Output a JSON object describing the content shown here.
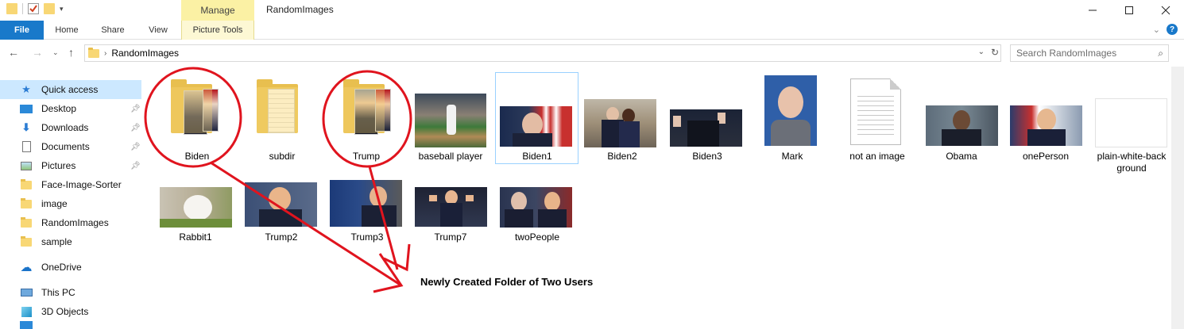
{
  "window": {
    "title": "RandomImages",
    "manage_tab": "Manage"
  },
  "ribbon": {
    "tabs": [
      {
        "label": "File"
      },
      {
        "label": "Home"
      },
      {
        "label": "Share"
      },
      {
        "label": "View"
      },
      {
        "label": "Picture Tools"
      }
    ]
  },
  "address": {
    "path": "RandomImages",
    "search_placeholder": "Search RandomImages"
  },
  "sidebar": {
    "items": [
      {
        "label": "Quick access",
        "icon": "star-icon",
        "selected": true
      },
      {
        "label": "Desktop",
        "icon": "desktop-icon",
        "pinned": true
      },
      {
        "label": "Downloads",
        "icon": "download-arrow-icon",
        "pinned": true
      },
      {
        "label": "Documents",
        "icon": "document-icon",
        "pinned": true
      },
      {
        "label": "Pictures",
        "icon": "pictures-icon",
        "pinned": true
      },
      {
        "label": "Face-Image-Sorter",
        "icon": "folder-icon"
      },
      {
        "label": "image",
        "icon": "folder-icon"
      },
      {
        "label": "RandomImages",
        "icon": "folder-icon"
      },
      {
        "label": "sample",
        "icon": "folder-icon"
      },
      {
        "label": "OneDrive",
        "icon": "cloud-icon"
      },
      {
        "label": "This PC",
        "icon": "computer-icon"
      },
      {
        "label": "3D Objects",
        "icon": "cube-icon"
      }
    ]
  },
  "files": [
    {
      "name": "Biden",
      "kind": "folder-with-photos"
    },
    {
      "name": "subdir",
      "kind": "folder"
    },
    {
      "name": "Trump",
      "kind": "folder-with-photos"
    },
    {
      "name": "baseball player",
      "kind": "image"
    },
    {
      "name": "Biden1",
      "kind": "image",
      "selected": true
    },
    {
      "name": "Biden2",
      "kind": "image"
    },
    {
      "name": "Biden3",
      "kind": "image"
    },
    {
      "name": "Mark",
      "kind": "image"
    },
    {
      "name": "not an image",
      "kind": "document"
    },
    {
      "name": "Obama",
      "kind": "image"
    },
    {
      "name": "onePerson",
      "kind": "image"
    },
    {
      "name": "plain-white-back\nground",
      "kind": "image"
    },
    {
      "name": "Rabbit1",
      "kind": "image"
    },
    {
      "name": "Trump2",
      "kind": "image"
    },
    {
      "name": "Trump3",
      "kind": "image"
    },
    {
      "name": "Trump7",
      "kind": "image"
    },
    {
      "name": "twoPeople",
      "kind": "image"
    }
  ],
  "annotation": {
    "text": "Newly Created Folder of Two Users",
    "color": "#e0141e"
  }
}
